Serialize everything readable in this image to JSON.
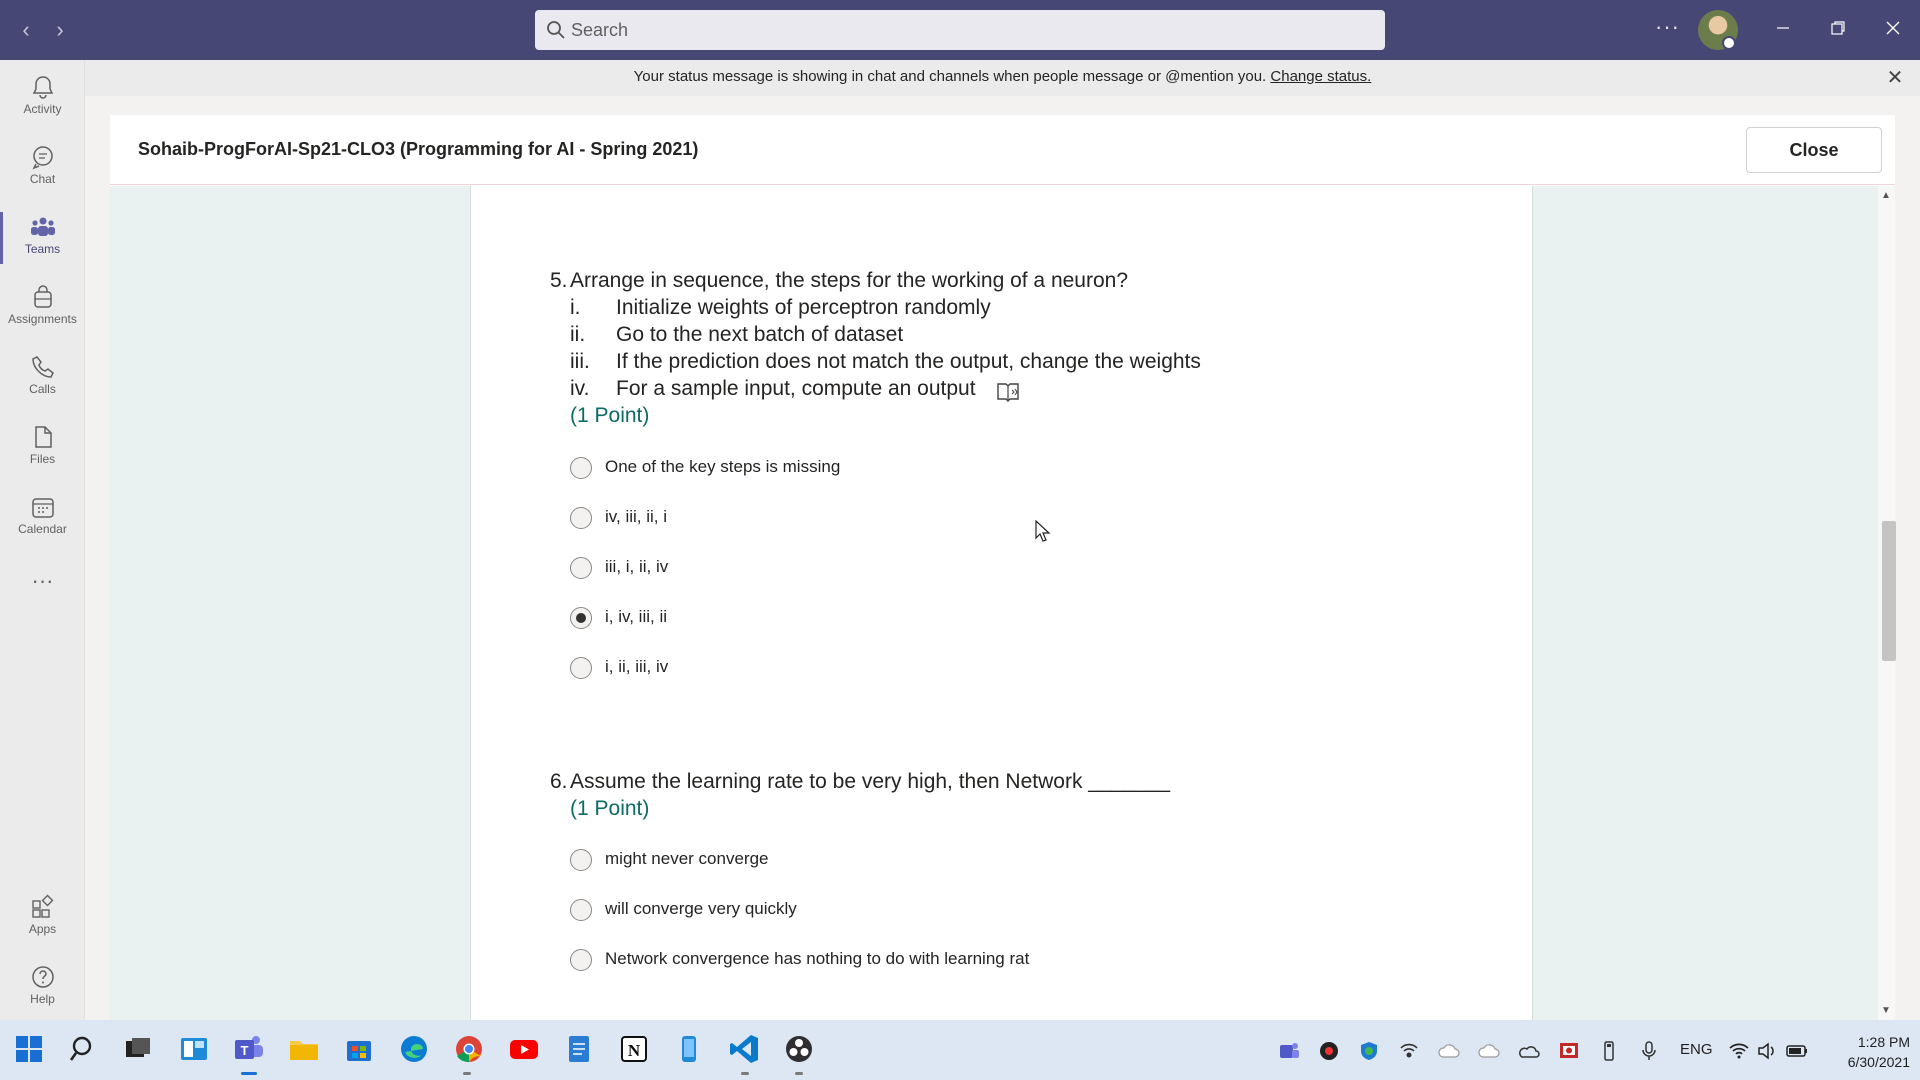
{
  "titlebar": {
    "back_icon": "chevron-left-icon",
    "forward_icon": "chevron-right-icon",
    "search_placeholder": "Search",
    "more_label": "···"
  },
  "rail": {
    "items": [
      {
        "label": "Activity",
        "icon": "bell-icon"
      },
      {
        "label": "Chat",
        "icon": "chat-icon"
      },
      {
        "label": "Teams",
        "icon": "teams-icon"
      },
      {
        "label": "Assignments",
        "icon": "assignments-icon"
      },
      {
        "label": "Calls",
        "icon": "phone-icon"
      },
      {
        "label": "Files",
        "icon": "file-icon"
      },
      {
        "label": "Calendar",
        "icon": "calendar-icon"
      }
    ],
    "more_label": "···",
    "bottom_items": [
      {
        "label": "Apps",
        "icon": "apps-icon"
      },
      {
        "label": "Help",
        "icon": "help-icon"
      }
    ]
  },
  "banner": {
    "message": "Your status message is showing in chat and channels when people message or @mention you.",
    "link": "Change status."
  },
  "dialog": {
    "title": "Sohaib-ProgForAI-Sp21-CLO3 (Programming for AI - Spring 2021)",
    "close_label": "Close"
  },
  "questions": [
    {
      "number": "5.",
      "text": "Arrange in sequence, the steps for the working of a neuron?",
      "steps": [
        {
          "num": "i.",
          "text": "Initialize weights of perceptron randomly"
        },
        {
          "num": "ii.",
          "text": "Go to the next batch of dataset"
        },
        {
          "num": "iii.",
          "text": "If the prediction does not match the output, change the weights"
        },
        {
          "num": "iv.",
          "text": "For a sample input, compute an output"
        }
      ],
      "points": "(1 Point)",
      "options": [
        {
          "label": "One of the key steps is missing",
          "selected": false
        },
        {
          "label": "iv, iii, ii, i",
          "selected": false
        },
        {
          "label": "iii, i, ii, iv",
          "selected": false
        },
        {
          "label": "i, iv, iii, ii",
          "selected": true
        },
        {
          "label": "i, ii, iii, iv",
          "selected": false
        }
      ]
    },
    {
      "number": "6.",
      "text": "Assume the learning rate to be very high, then Network _______",
      "points": "(1 Point)",
      "options": [
        {
          "label": "might never converge",
          "selected": false
        },
        {
          "label": "will converge very quickly",
          "selected": false
        },
        {
          "label": "Network convergence has nothing to do with learning rat",
          "selected": false
        }
      ]
    }
  ],
  "taskbar": {
    "language": "ENG",
    "time": "1:28 PM",
    "date": "6/30/2021"
  },
  "colors": {
    "titlebar": "#464775",
    "accent": "#6264a7",
    "points": "#0c6b63",
    "form_bg": "#e9f2f1"
  }
}
